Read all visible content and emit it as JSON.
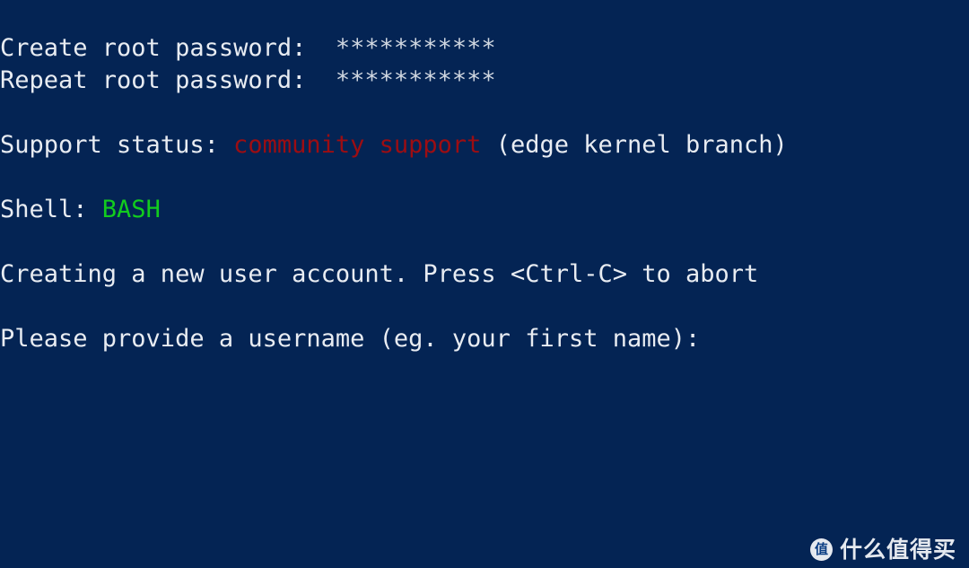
{
  "terminal": {
    "background_color": "#042454",
    "default_text_color": "#e8ecf2",
    "accent_red": "#9d0d12",
    "accent_green": "#12cc1e",
    "lines": [
      {
        "id": "create-root-password",
        "segments": [
          {
            "text": "Create root password:  ",
            "color": "white"
          },
          {
            "text": "***********",
            "color": "stars"
          }
        ]
      },
      {
        "id": "repeat-root-password",
        "segments": [
          {
            "text": "Repeat root password:  ",
            "color": "white"
          },
          {
            "text": "***********",
            "color": "stars"
          }
        ]
      },
      {
        "id": "blank-1",
        "segments": [
          {
            "text": " ",
            "color": "white"
          }
        ]
      },
      {
        "id": "support-status",
        "segments": [
          {
            "text": "Support status: ",
            "color": "white"
          },
          {
            "text": "community support",
            "color": "red"
          },
          {
            "text": " (edge kernel branch)",
            "color": "white"
          }
        ]
      },
      {
        "id": "blank-2",
        "segments": [
          {
            "text": " ",
            "color": "white"
          }
        ]
      },
      {
        "id": "shell",
        "segments": [
          {
            "text": "Shell: ",
            "color": "white"
          },
          {
            "text": "BASH",
            "color": "green"
          }
        ]
      },
      {
        "id": "blank-3",
        "segments": [
          {
            "text": " ",
            "color": "white"
          }
        ]
      },
      {
        "id": "creating-user-account",
        "segments": [
          {
            "text": "Creating a new user account. Press <Ctrl-C> to abort",
            "color": "white"
          }
        ]
      },
      {
        "id": "blank-4",
        "segments": [
          {
            "text": " ",
            "color": "white"
          }
        ]
      },
      {
        "id": "username-prompt",
        "segments": [
          {
            "text": "Please provide a username (eg. your first name):",
            "color": "white"
          }
        ]
      }
    ]
  },
  "watermark": {
    "badge_glyph": "值",
    "label": "什么值得买"
  }
}
